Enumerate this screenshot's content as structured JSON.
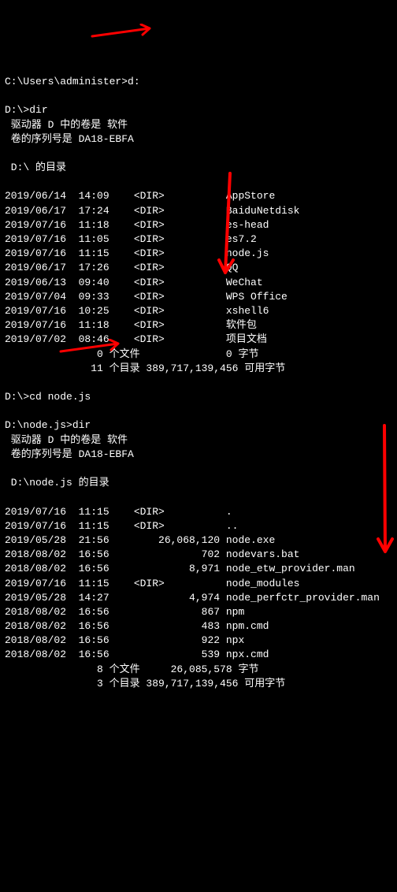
{
  "lines": {
    "p1_prompt": "C:\\Users\\administer>",
    "p1_cmd": "d:",
    "blank": "",
    "p2_prompt": "D:\\>",
    "p2_cmd": "dir",
    "vol1": " 驱动器 D 中的卷是 软件",
    "ser1": " 卷的序列号是 DA18-EBFA",
    "hdr1": " D:\\ 的目录",
    "d1": [
      "2019/06/14  14:09    <DIR>          AppStore",
      "2019/06/17  17:24    <DIR>          BaiduNetdisk",
      "2019/07/16  11:18    <DIR>          es-head",
      "2019/07/16  11:05    <DIR>          es7.2",
      "2019/07/16  11:15    <DIR>          node.js",
      "2019/06/17  17:26    <DIR>          QQ",
      "2019/06/13  09:40    <DIR>          WeChat",
      "2019/07/04  09:33    <DIR>          WPS Office",
      "2019/07/16  10:25    <DIR>          xshell6",
      "2019/07/16  11:18    <DIR>          软件包",
      "2019/07/02  08:46    <DIR>          项目文档"
    ],
    "sum1a": "               0 个文件              0 字节",
    "sum1b": "              11 个目录 389,717,139,456 可用字节",
    "p3_prompt": "D:\\>",
    "p3_cmd": "cd node.js",
    "p4_prompt": "D:\\node.js>",
    "p4_cmd": "dir",
    "vol2": " 驱动器 D 中的卷是 软件",
    "ser2": " 卷的序列号是 DA18-EBFA",
    "hdr2": " D:\\node.js 的目录",
    "d2": [
      "2019/07/16  11:15    <DIR>          .",
      "2019/07/16  11:15    <DIR>          ..",
      "2019/05/28  21:56        26,068,120 node.exe",
      "2018/08/02  16:56               702 nodevars.bat",
      "2018/08/02  16:56             8,971 node_etw_provider.man",
      "2019/07/16  11:15    <DIR>          node_modules",
      "2019/05/28  14:27             4,974 node_perfctr_provider.man",
      "2018/08/02  16:56               867 npm",
      "2018/08/02  16:56               483 npm.cmd",
      "2018/08/02  16:56               922 npx",
      "2018/08/02  16:56               539 npx.cmd"
    ],
    "sum2a": "               8 个文件     26,085,578 字节",
    "sum2b": "               3 个目录 389,717,139,456 可用字节"
  },
  "arrows": {
    "a1": {
      "color": "#ff0000"
    },
    "a2": {
      "color": "#ff0000"
    },
    "a3": {
      "color": "#ff0000"
    },
    "a4": {
      "color": "#ff0000"
    }
  }
}
